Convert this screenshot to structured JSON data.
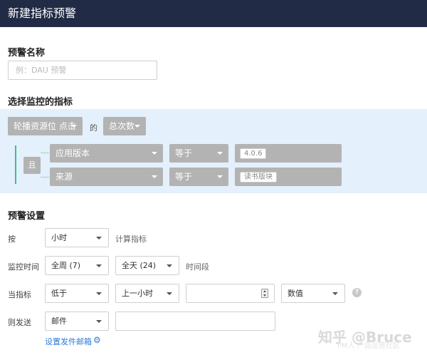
{
  "window": {
    "title": "新建指标预警"
  },
  "name_section": {
    "heading": "预警名称",
    "input_placeholder": "例：DAU 预警"
  },
  "metric_section": {
    "heading": "选择监控的指标",
    "event_dropdown": "轮播资源位 点击",
    "of_text": "的",
    "measure_dropdown": "总次数",
    "and_label": "且",
    "filters": [
      {
        "field": "应用版本",
        "operator": "等于",
        "value": "4.0.6"
      },
      {
        "field": "来源",
        "operator": "等于",
        "value": "读书版块"
      }
    ]
  },
  "settings_section": {
    "heading": "预警设置",
    "rows": {
      "by": {
        "label": "按",
        "select": "小时",
        "suffix": "计算指标"
      },
      "monitor_time": {
        "label": "监控时间",
        "week_select": "全周 (7)",
        "day_select": "全天 (24)",
        "suffix": "时间段"
      },
      "condition": {
        "label": "当指标",
        "compare_select": "低于",
        "period_select": "上一小时",
        "value": "",
        "unit_select": "数值",
        "help_icon": "?"
      },
      "send": {
        "label": "则发送",
        "channel_select": "邮件",
        "recipient": ""
      }
    },
    "configure_link": "设置发件邮箱",
    "gear_icon": "⚙"
  },
  "watermark": {
    "line1": "知乎 @Bruce",
    "line2": "PM人 产品运营社区"
  }
}
